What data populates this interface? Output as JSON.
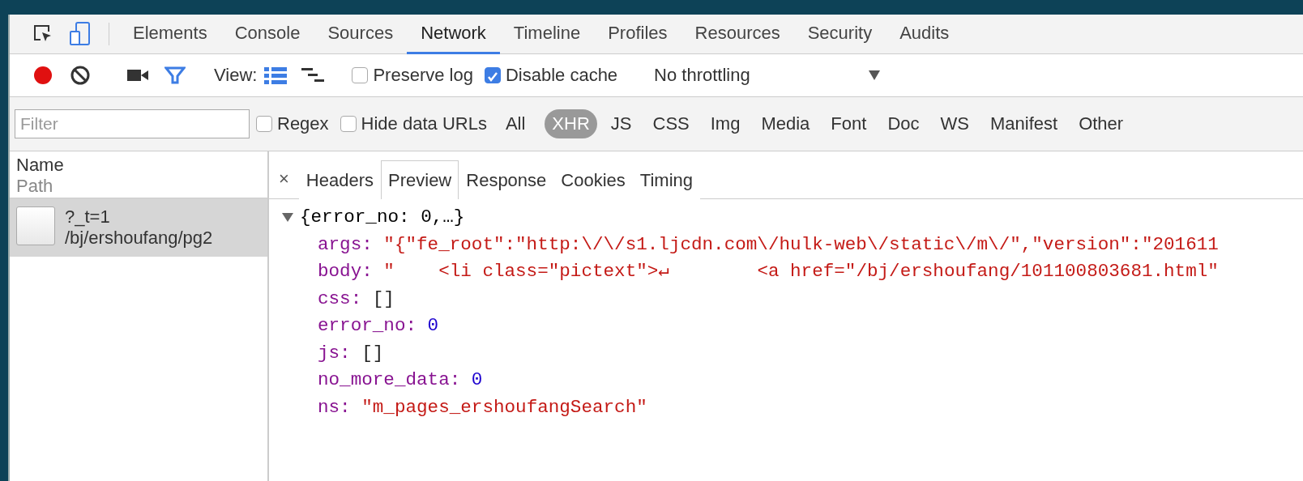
{
  "panel_tabs": [
    {
      "label": "Elements",
      "selected": false
    },
    {
      "label": "Console",
      "selected": false
    },
    {
      "label": "Sources",
      "selected": false
    },
    {
      "label": "Network",
      "selected": true
    },
    {
      "label": "Timeline",
      "selected": false
    },
    {
      "label": "Profiles",
      "selected": false
    },
    {
      "label": "Resources",
      "selected": false
    },
    {
      "label": "Security",
      "selected": false
    },
    {
      "label": "Audits",
      "selected": false
    }
  ],
  "toolbar": {
    "recording": true,
    "filter_on": true,
    "view_label": "View:",
    "view_modes": [
      {
        "kind": "list",
        "selected": true
      },
      {
        "kind": "waterfall",
        "selected": false
      }
    ],
    "preserve_log": {
      "label": "Preserve log",
      "checked": false
    },
    "disable_cache": {
      "label": "Disable cache",
      "checked": true
    },
    "throttling": {
      "value": "No throttling"
    }
  },
  "filter_bar": {
    "placeholder": "Filter",
    "regex": {
      "label": "Regex",
      "checked": false
    },
    "hide_data_urls": {
      "label": "Hide data URLs",
      "checked": false
    },
    "types": [
      {
        "label": "All",
        "selected": false
      },
      {
        "label": "XHR",
        "selected": true
      },
      {
        "label": "JS",
        "selected": false
      },
      {
        "label": "CSS",
        "selected": false
      },
      {
        "label": "Img",
        "selected": false
      },
      {
        "label": "Media",
        "selected": false
      },
      {
        "label": "Font",
        "selected": false
      },
      {
        "label": "Doc",
        "selected": false
      },
      {
        "label": "WS",
        "selected": false
      },
      {
        "label": "Manifest",
        "selected": false
      },
      {
        "label": "Other",
        "selected": false
      }
    ]
  },
  "request_list": {
    "header": {
      "name": "Name",
      "sub": "Path"
    },
    "requests": [
      {
        "name": "?_t=1",
        "path": "/bj/ershoufang/pg2",
        "selected": true
      }
    ]
  },
  "detail": {
    "close": "×",
    "tabs": [
      {
        "label": "Headers",
        "selected": false
      },
      {
        "label": "Preview",
        "selected": true
      },
      {
        "label": "Response",
        "selected": false
      },
      {
        "label": "Cookies",
        "selected": false
      },
      {
        "label": "Timing",
        "selected": false
      }
    ],
    "preview": {
      "expanded": true,
      "summary": "{error_no: 0,…}",
      "properties": [
        {
          "key": "args:",
          "kind": "string",
          "value": "\"{\"fe_root\":\"http:\\/\\/s1.ljcdn.com\\/hulk-web\\/static\\/m\\/\",\"version\":\"201611"
        },
        {
          "key": "body:",
          "kind": "string",
          "value": "\"    <li class=\"pictext\">↵        <a href=\"/bj/ershoufang/101100803681.html\""
        },
        {
          "key": "css:",
          "kind": "array",
          "value": "[]"
        },
        {
          "key": "error_no:",
          "kind": "number",
          "value": "0"
        },
        {
          "key": "js:",
          "kind": "array",
          "value": "[]"
        },
        {
          "key": "no_more_data:",
          "kind": "number",
          "value": "0"
        },
        {
          "key": "ns:",
          "kind": "string",
          "value": "\"m_pages_ershoufangSearch\""
        }
      ]
    }
  }
}
